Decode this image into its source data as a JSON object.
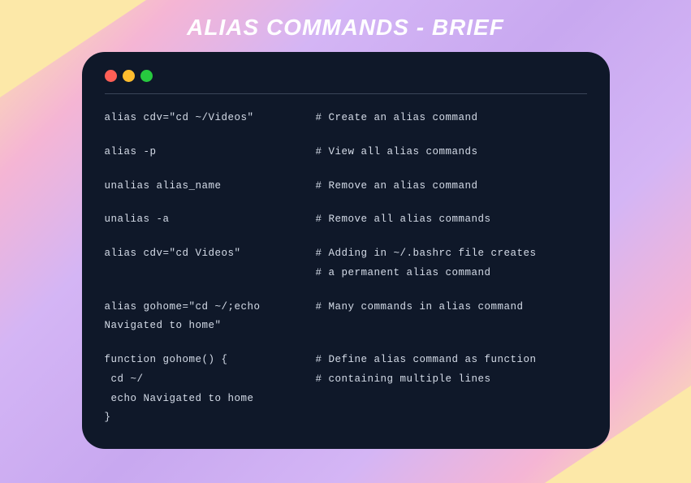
{
  "title": "ALIAS COMMANDS - BRIEF",
  "entries": [
    {
      "command_lines": [
        "alias cdv=\"cd ~/Videos\""
      ],
      "comment_lines": [
        "# Create an alias command"
      ]
    },
    {
      "command_lines": [
        "alias -p"
      ],
      "comment_lines": [
        "# View all alias commands"
      ]
    },
    {
      "command_lines": [
        "unalias alias_name"
      ],
      "comment_lines": [
        "# Remove an alias command"
      ]
    },
    {
      "command_lines": [
        "unalias -a"
      ],
      "comment_lines": [
        "# Remove all alias commands"
      ]
    },
    {
      "command_lines": [
        "alias cdv=\"cd Videos\""
      ],
      "comment_lines": [
        "# Adding in ~/.bashrc file creates",
        "# a permanent alias command"
      ]
    },
    {
      "command_lines": [
        "alias gohome=\"cd ~/;echo",
        "Navigated to home\""
      ],
      "comment_lines": [
        "# Many commands in alias command"
      ]
    },
    {
      "command_lines": [
        "function gohome() {",
        " cd ~/",
        " echo Navigated to home",
        "}"
      ],
      "comment_lines": [
        "# Define alias command as function",
        "# containing multiple lines"
      ]
    }
  ]
}
